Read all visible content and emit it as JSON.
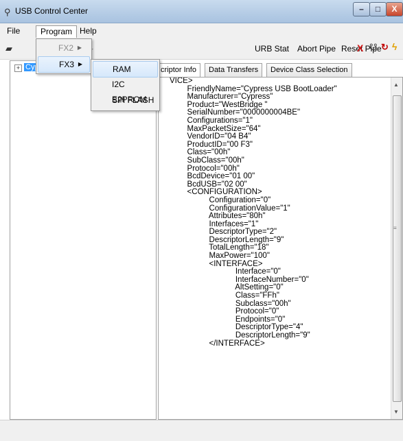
{
  "window": {
    "title": "USB Control Center",
    "min_glyph": "–",
    "max_glyph": "□",
    "close_glyph": "X"
  },
  "menubar": {
    "items": [
      "File",
      "Program",
      "Help"
    ]
  },
  "program_menu": {
    "items": [
      {
        "label": "FX2",
        "disabled": true
      },
      {
        "label": "FX3",
        "disabled": false
      }
    ]
  },
  "fx3_submenu": {
    "items": [
      "RAM",
      "I2C E2PROM",
      "SPI FLASH"
    ]
  },
  "toolbar": {
    "urb_stat": "URB Stat",
    "abort_pipe": "Abort Pipe",
    "reset_pipe": "Reset Pipe",
    "stop_glyph": "X"
  },
  "tree": {
    "expander": "+",
    "node_label": "Cyp"
  },
  "tabs": [
    "criptor Info",
    "Data Transfers",
    "Device Class Selection"
  ],
  "descriptor_lines": [
    "VICE>",
    "        FriendlyName=\"Cypress USB BootLoader\"",
    "        Manufacturer=\"Cypress\"",
    "        Product=\"WestBridge \"",
    "        SerialNumber=\"0000000004BE\"",
    "        Configurations=\"1\"",
    "        MaxPacketSize=\"64\"",
    "        VendorID=\"04 B4\"",
    "        ProductID=\"00 F3\"",
    "        Class=\"00h\"",
    "        SubClass=\"00h\"",
    "        Protocol=\"00h\"",
    "        BcdDevice=\"01 00\"",
    "        BcdUSB=\"02 00\"",
    "        <CONFIGURATION>",
    "                  Configuration=\"0\"",
    "                  ConfigurationValue=\"1\"",
    "                  Attributes=\"80h\"",
    "                  Interfaces=\"1\"",
    "                  DescriptorType=\"2\"",
    "                  DescriptorLength=\"9\"",
    "                  TotalLength=\"18\"",
    "                  MaxPower=\"100\"",
    "                  <INTERFACE>",
    "                              Interface=\"0\"",
    "                              InterfaceNumber=\"0\"",
    "                              AltSetting=\"0\"",
    "                              Class=\"FFh\"",
    "                              Subclass=\"00h\"",
    "                              Protocol=\"0\"",
    "                              Endpoints=\"0\"",
    "                              DescriptorType=\"4\"",
    "                              DescriptorLength=\"9\"",
    "                  </INTERFACE>"
  ]
}
